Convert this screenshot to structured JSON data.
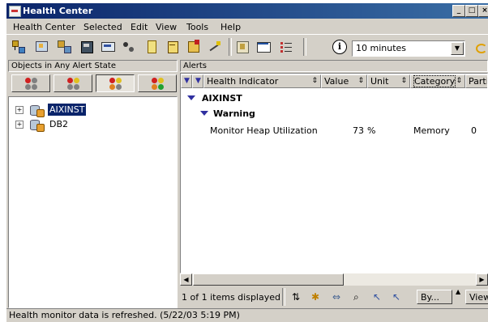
{
  "window": {
    "title": "Health Center"
  },
  "menu": [
    "Health Center",
    "Selected",
    "Edit",
    "View",
    "Tools",
    "Help"
  ],
  "toolbar": {
    "icons": [
      "tree-icon",
      "network-icon",
      "hierarchy-icon",
      "database-icon",
      "monitor-icon",
      "config-icon",
      "book-icon",
      "journal-icon",
      "check-icon",
      "wizard-icon",
      "launchpad-icon",
      "window-icon",
      "list-icon"
    ],
    "info_icon": "info-icon",
    "refresh_interval": "10 minutes"
  },
  "left_panel": {
    "header": "Objects in Any Alert State",
    "filter_tabs": [
      {
        "name": "alarm-filter",
        "active": false
      },
      {
        "name": "alarm-warning-filter",
        "active": false
      },
      {
        "name": "alarm-warning-attention-filter",
        "active": true
      },
      {
        "name": "all-states-filter",
        "active": false
      }
    ],
    "tree": [
      {
        "label": "AIXINST",
        "selected": true
      },
      {
        "label": "DB2",
        "selected": false
      }
    ]
  },
  "alerts": {
    "header": "Alerts",
    "columns": [
      "Health Indicator",
      "Value",
      "Unit",
      "Category",
      "Partiti"
    ],
    "instance": "AIXINST",
    "severity": "Warning",
    "rows": [
      {
        "indicator": "Monitor Heap Utilization",
        "value": "73",
        "unit": "%",
        "category": "Memory",
        "partition": "0"
      }
    ],
    "count_text": "1 of 1 items displayed",
    "by_label": "By...",
    "view_label": "View"
  },
  "status": "Health monitor data is refreshed. (5/22/03 5:19 PM)"
}
